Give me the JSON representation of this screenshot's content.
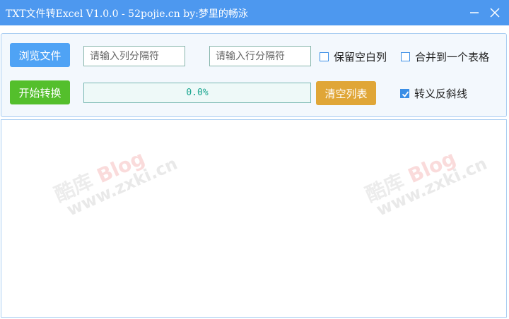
{
  "window": {
    "title": "TXT文件转Excel V1.0.0 - 52pojie.cn by:梦里的畅泳"
  },
  "toolbar": {
    "browse_label": "浏览文件",
    "start_label": "开始转换",
    "clear_label": "清空列表",
    "column_separator": {
      "value": "",
      "placeholder": "请输入列分隔符"
    },
    "row_separator": {
      "value": "",
      "placeholder": "请输入行分隔符"
    },
    "progress": {
      "text": "0.0%",
      "percent": 0
    },
    "keep_blank_column": {
      "label": "保留空白列",
      "checked": false
    },
    "merge_into_one_sheet": {
      "label": "合并到一个表格",
      "checked": false
    },
    "escape_backslash": {
      "label": "转义反斜线",
      "checked": true
    }
  },
  "watermark": {
    "brand_cn": "酷库",
    "brand_en": "Blog",
    "url": "www.zxki.cn"
  },
  "colors": {
    "titlebar": "#4d98ef",
    "browse_button": "#4fa3f5",
    "start_button": "#54bf2c",
    "clear_button": "#e0a637",
    "checkbox": "#3a8ee6"
  },
  "icons": {
    "minimize": "minimize-icon",
    "close": "close-icon",
    "check": "checkmark-icon"
  }
}
